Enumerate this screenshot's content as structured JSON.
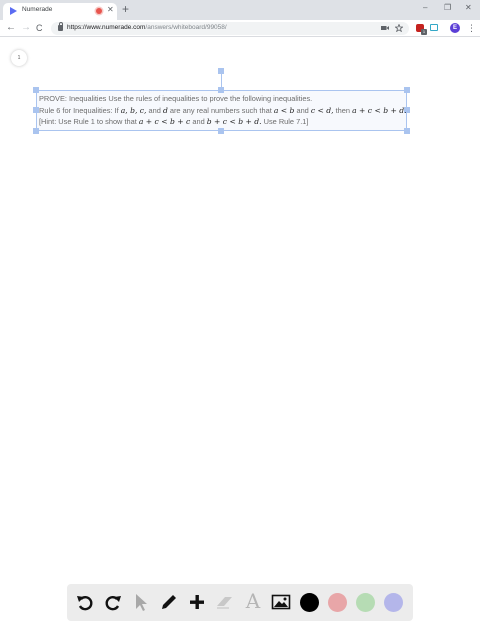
{
  "browser": {
    "tab_title": "Numerade",
    "tab_close": "✕",
    "new_tab": "+",
    "window_controls": {
      "minimize": "–",
      "maximize": "❐",
      "close": "✕"
    },
    "nav": {
      "back": "←",
      "forward": "→",
      "reload": "C"
    },
    "url_scheme_host": "https://www.numerade.com",
    "url_path": "/answers/whiteboard/99058/",
    "omnibox_icons": [
      "camera-icon",
      "star-icon"
    ],
    "extension_badge": "1",
    "profile_initial": "E",
    "menu": "⋮"
  },
  "whiteboard": {
    "page_number": "1",
    "problem": {
      "line1": "PROVE: Inequalities Use the rules of inequalities to prove the following inequalities.",
      "line2_prefix": "Rule 6 for Inequalities: If ",
      "line2_vars": "a, b, c,",
      "line2_and": " and ",
      "line2_d": "d",
      "line2_mid": " are any real numbers such that ",
      "line2_c1": "a < b",
      "line2_and2": " and ",
      "line2_c2": "c < d,",
      "line2_then": " then ",
      "line2_concl": "a + c < b + d.",
      "line3_prefix": "[Hint: Use Rule 1 to show that ",
      "line3_e1": "a + c < b + c",
      "line3_and": " and ",
      "line3_e2": "b + c < b + d.",
      "line3_suffix": " Use Rule 7.1]"
    }
  },
  "draw_toolbar": {
    "tools": [
      "undo-icon",
      "redo-icon",
      "pointer-icon",
      "pencil-icon",
      "plus-icon",
      "eraser-icon",
      "text-icon",
      "image-icon"
    ],
    "text_tool_glyph": "A",
    "colors": [
      "#000000",
      "#e8a6a8",
      "#b6dcb4",
      "#b4b6ea"
    ]
  }
}
